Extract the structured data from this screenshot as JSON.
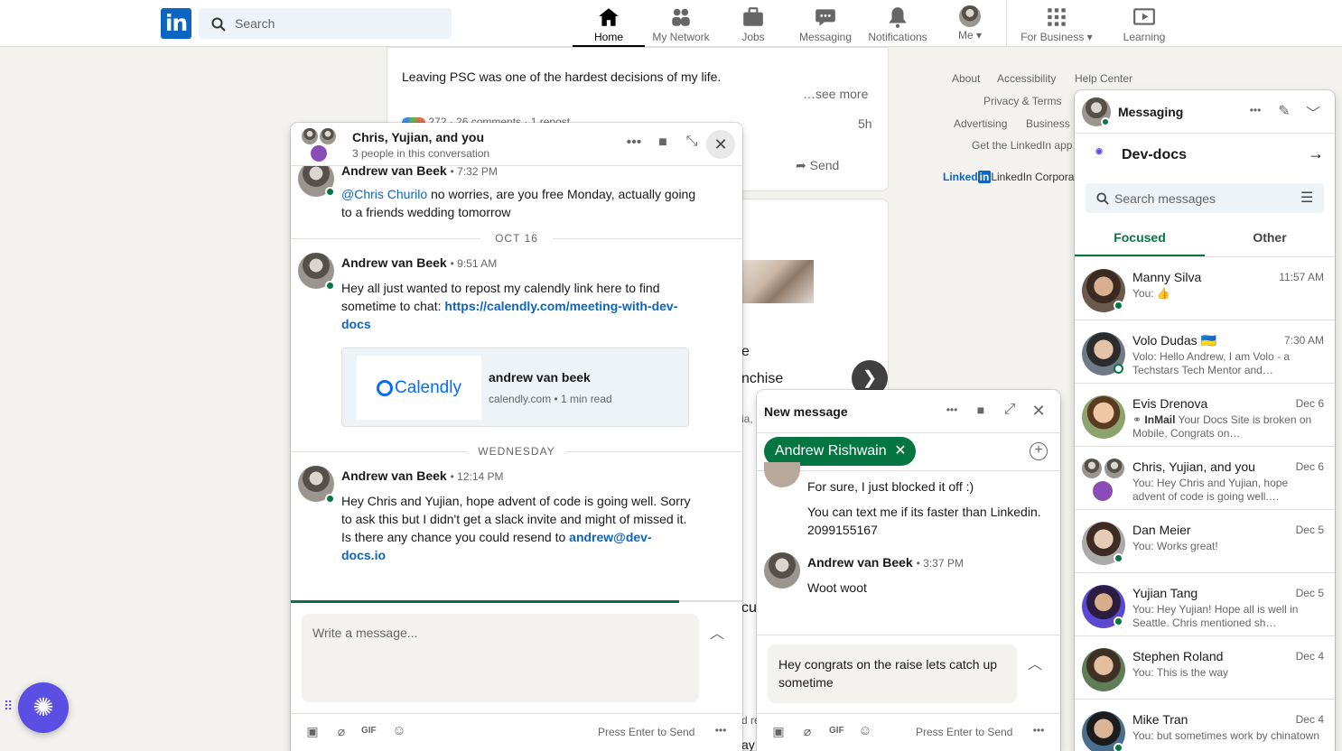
{
  "nav": {
    "search_placeholder": "Search",
    "items": [
      {
        "label": "Home",
        "icon": "home-icon"
      },
      {
        "label": "My Network",
        "icon": "network-icon"
      },
      {
        "label": "Jobs",
        "icon": "briefcase-icon"
      },
      {
        "label": "Messaging",
        "icon": "chat-icon"
      },
      {
        "label": "Notifications",
        "icon": "bell-icon"
      },
      {
        "label": "Me",
        "icon": "avatar"
      },
      {
        "label": "For Business",
        "icon": "grid-icon"
      },
      {
        "label": "Learning",
        "icon": "learning-icon"
      }
    ]
  },
  "feed": {
    "post_text": "Leaving PSC was one of the hardest decisions of my life.",
    "see_more": "…see more",
    "stats": "272 · 26 comments · 1 repost",
    "time": "5h",
    "send_label": "Send",
    "partial_1": "e",
    "partial_2": "nchise",
    "partial_3": "ia,",
    "partial_4": "cus",
    "partial_5": "d rec",
    "partial_6": "ay i"
  },
  "footer": {
    "about": "About",
    "accessibility": "Accessibility",
    "help": "Help Center",
    "privacy": "Privacy & Terms",
    "advertising": "Advertising",
    "business": "Business",
    "getapp": "Get the LinkedIn app",
    "corp": "LinkedIn Corporation"
  },
  "group_chat": {
    "title": "Chris, Yujian, and you",
    "subtitle": "3 people in this conversation",
    "m1_name": "Andrew van Beek",
    "m1_time": "7:32 PM",
    "m1_mention": "@Chris Churilo",
    "m1_text": " no worries, are you free Monday, actually going to a friends wedding tomorrow",
    "date1": "OCT 16",
    "m2_name": "Andrew van Beek",
    "m2_time": "9:51 AM",
    "m2_text": "Hey all just wanted to repost my calendly link here to find sometime to chat: ",
    "m2_link": "https://calendly.com/meeting-with-dev-docs",
    "preview_brand": "Calendly",
    "preview_title": "andrew van beek",
    "preview_meta": "calendly.com • 1 min read",
    "date2": "WEDNESDAY",
    "m3_name": "Andrew van Beek",
    "m3_time": "12:14 PM",
    "m3_text": "Hey Chris and Yujian, hope advent of code is going well. Sorry to ask this but I didn't get a slack invite and might of missed it. Is there any chance you could resend to ",
    "m3_link": "andrew@dev-docs.io",
    "input_placeholder": "Write a message...",
    "send_hint": "Press Enter to Send"
  },
  "new_msg": {
    "title": "New message",
    "recipient": "Andrew Rishwain",
    "m1_text": "For sure, I just blocked it off :)",
    "m2_text": "You can text me if its faster than Linkedin. 2099155167",
    "m3_name": "Andrew van Beek",
    "m3_time": "3:37 PM",
    "m3_text": "Woot woot",
    "draft": "Hey congrats on the raise lets catch up sometime",
    "send_hint": "Press Enter to Send"
  },
  "messaging": {
    "title": "Messaging",
    "page_name": "Dev-docs",
    "search_placeholder": "Search messages",
    "tab_focused": "Focused",
    "tab_other": "Other",
    "conversations": [
      {
        "name": "Manny Silva",
        "time": "11:57 AM",
        "preview": "You: 👍"
      },
      {
        "name": "Volo Dudas 🇺🇦",
        "time": "7:30 AM",
        "preview": "Volo: Hello Andrew, I am Volo - a Techstars Tech Mentor and…"
      },
      {
        "name": "Evis Drenova",
        "time": "Dec 6",
        "inmail": "InMail",
        "preview": "Your Docs Site is broken on Mobile, Congrats on…"
      },
      {
        "name": "Chris, Yujian, and you",
        "time": "Dec 6",
        "preview": "You: Hey Chris and Yujian, hope advent of code is going well.…"
      },
      {
        "name": "Dan Meier",
        "time": "Dec 5",
        "preview": "You: Works great!"
      },
      {
        "name": "Yujian Tang",
        "time": "Dec 5",
        "preview": "You: Hey Yujian! Hope all is well in Seattle. Chris mentioned sh…"
      },
      {
        "name": "Stephen Roland",
        "time": "Dec 4",
        "preview": "You: This is the way"
      },
      {
        "name": "Mike Tran",
        "time": "Dec 4",
        "preview": "You: but sometimes work by chinatown"
      }
    ]
  }
}
